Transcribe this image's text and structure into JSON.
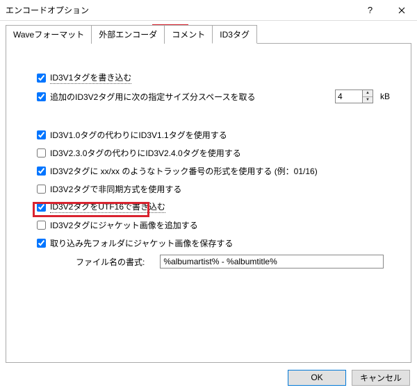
{
  "window": {
    "title": "エンコードオプション"
  },
  "tabs": {
    "t1": "Waveフォーマット",
    "t2": "外部エンコーダ",
    "t3": "コメント",
    "t4": "ID3タグ"
  },
  "opts": {
    "cb1": {
      "label": "ID3V1タグを書き込む",
      "checked": true
    },
    "cb2": {
      "label": "追加のID3V2タグ用に次の指定サイズ分スペースを取る",
      "checked": true
    },
    "sizekb": "4",
    "kb": "kB",
    "cb3": {
      "label": "ID3V1.0タグの代わりにID3V1.1タグを使用する",
      "checked": true
    },
    "cb4": {
      "label": "ID3V2.3.0タグの代わりにID3V2.4.0タグを使用する",
      "checked": false
    },
    "cb5": {
      "label": "ID3V2タグに xx/xx のようなトラック番号の形式を使用する (例：01/16)",
      "checked": true
    },
    "cb6": {
      "label": "ID3V2タグで非同期方式を使用する",
      "checked": false
    },
    "cb7": {
      "label": "ID3V2タグをUTF16で書き込む",
      "checked": true
    },
    "cb8": {
      "label": "ID3V2タグにジャケット画像を追加する",
      "checked": false
    },
    "cb9": {
      "label": "取り込み先フォルダにジャケット画像を保存する",
      "checked": true
    },
    "fname_label": "ファイル名の書式:",
    "fname_value": "%albumartist% - %albumtitle%"
  },
  "buttons": {
    "ok": "OK",
    "cancel": "キャンセル"
  }
}
